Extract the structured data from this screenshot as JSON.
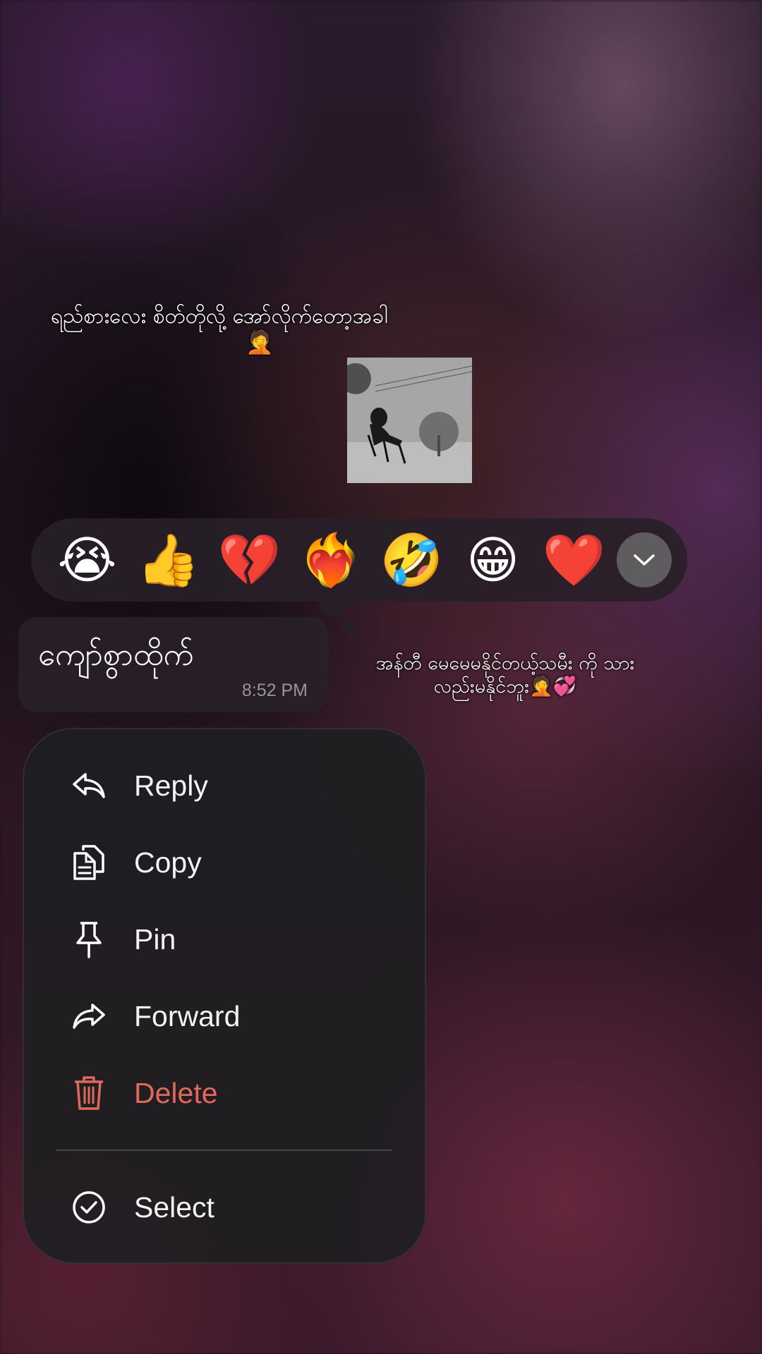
{
  "background_caption": {
    "line1": "ရည်စားလေး စိတ်တိုလို့ အော်လိုက်တော့အခါ",
    "line1_emoji": "🤦",
    "line2": "အန်တီ မေမေမနိုင်တယ့်သမီး ကို သားလည်းမနိုင်ဘူး🤦💞"
  },
  "reactions": [
    {
      "emoji": "😭",
      "name": "loudly-crying"
    },
    {
      "emoji": "👍",
      "name": "thumbs-up"
    },
    {
      "emoji": "💔",
      "name": "broken-heart"
    },
    {
      "emoji": "❤️‍🔥",
      "name": "heart-on-fire"
    },
    {
      "emoji": "🤣",
      "name": "rolling-laughing"
    },
    {
      "emoji": "😁",
      "name": "beaming-grin"
    },
    {
      "emoji": "❤️",
      "name": "red-heart"
    }
  ],
  "message": {
    "text": "ကျော်စွာထိုက်",
    "time": "8:52 PM"
  },
  "menu": {
    "reply": "Reply",
    "copy": "Copy",
    "pin": "Pin",
    "forward": "Forward",
    "delete": "Delete",
    "select": "Select"
  },
  "colors": {
    "danger": "#e2685c",
    "menu_bg": "#201e22",
    "bubble_bg": "#282028"
  }
}
